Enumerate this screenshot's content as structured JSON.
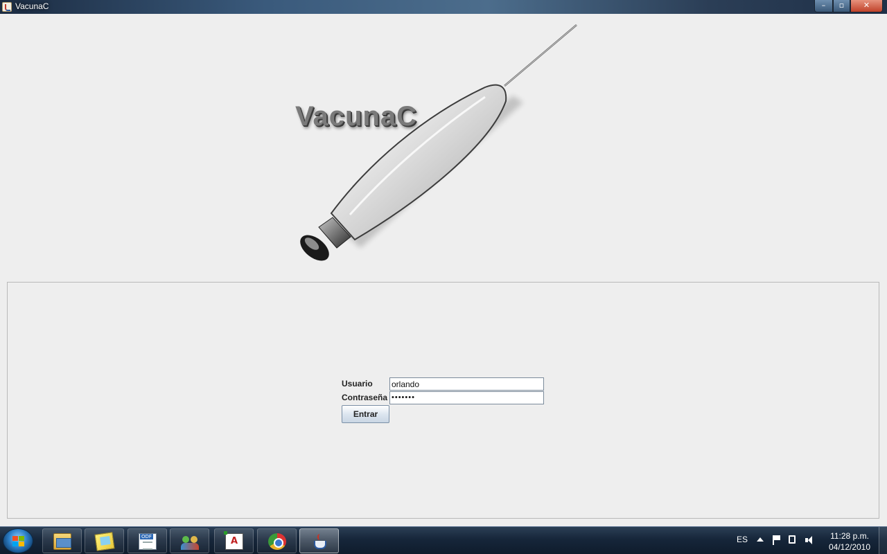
{
  "window": {
    "title": "VacunaC",
    "controls": {
      "minimize": "–",
      "maximize": "▫",
      "close": "✕"
    }
  },
  "logo": {
    "text": "VacunaC",
    "icon": "syringe-logo"
  },
  "login": {
    "username_label": "Usuario",
    "username_value": "orlando",
    "password_label": "Contraseña",
    "password_value": "•••••••",
    "submit_label": "Entrar"
  },
  "taskbar": {
    "apps": [
      {
        "name": "Explorador",
        "icon": "folder-icon"
      },
      {
        "name": "Notas",
        "icon": "sticky-notes-icon"
      },
      {
        "name": "ODF",
        "icon": "odf-document-icon"
      },
      {
        "name": "Usuarios",
        "icon": "people-icon"
      },
      {
        "name": "Dia",
        "icon": "dia-icon"
      },
      {
        "name": "Chrome",
        "icon": "chrome-icon"
      },
      {
        "name": "Java",
        "icon": "java-icon",
        "active": true
      }
    ],
    "tray": {
      "language": "ES",
      "time": "11:28 p.m.",
      "date": "04/12/2010"
    }
  },
  "colors": {
    "background": "#eeeeee",
    "panel_border": "#b8b8b8",
    "titlebar": "#3a5a7c",
    "taskbar": "#16263a"
  }
}
